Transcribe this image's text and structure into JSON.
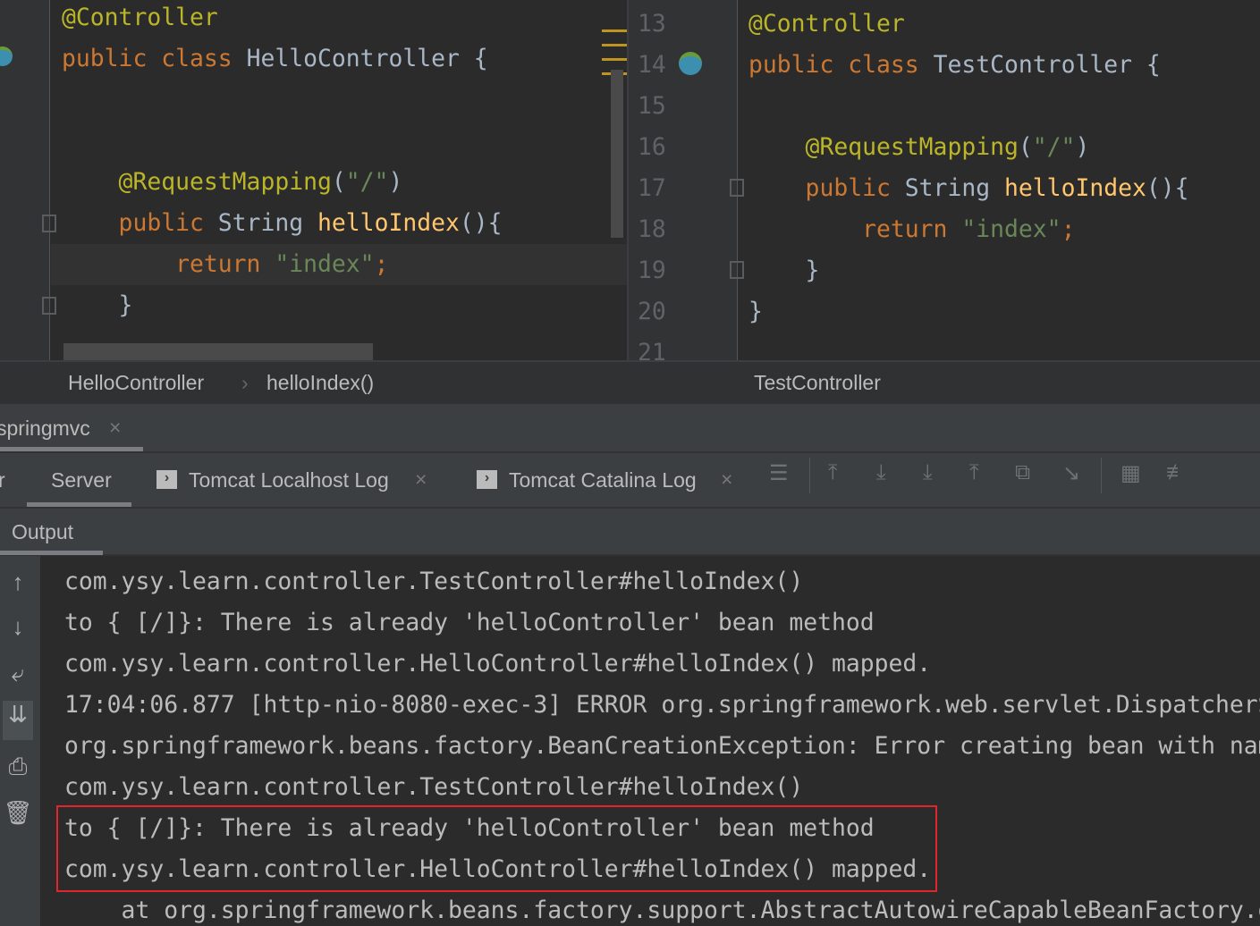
{
  "left_editor": {
    "lines": [
      [
        {
          "t": "@Controller",
          "c": "an"
        }
      ],
      [
        {
          "t": "public ",
          "c": "kw"
        },
        {
          "t": "class ",
          "c": "kw"
        },
        {
          "t": "HelloController {",
          "c": "tx"
        }
      ],
      [],
      [],
      [
        {
          "t": "    @RequestMapping",
          "c": "an"
        },
        {
          "t": "(",
          "c": "tx"
        },
        {
          "t": "\"/\"",
          "c": "st"
        },
        {
          "t": ")",
          "c": "tx"
        }
      ],
      [
        {
          "t": "    public ",
          "c": "kw"
        },
        {
          "t": "String ",
          "c": "tx"
        },
        {
          "t": "helloIndex",
          "c": "fn"
        },
        {
          "t": "(){",
          "c": "tx"
        }
      ],
      [
        {
          "t": "        return ",
          "c": "kw"
        },
        {
          "t": "\"index\"",
          "c": "st"
        },
        {
          "t": ";",
          "c": "kw"
        }
      ],
      [
        {
          "t": "    }",
          "c": "tx"
        }
      ]
    ]
  },
  "right_editor": {
    "line_numbers": [
      "13",
      "14",
      "15",
      "16",
      "17",
      "18",
      "19",
      "20",
      "21"
    ],
    "lines": [
      [
        {
          "t": "@Controller",
          "c": "an"
        }
      ],
      [
        {
          "t": "public ",
          "c": "kw"
        },
        {
          "t": "class ",
          "c": "kw"
        },
        {
          "t": "TestController {",
          "c": "tx"
        }
      ],
      [],
      [
        {
          "t": "    @RequestMapping",
          "c": "an"
        },
        {
          "t": "(",
          "c": "tx"
        },
        {
          "t": "\"/\"",
          "c": "st"
        },
        {
          "t": ")",
          "c": "tx"
        }
      ],
      [
        {
          "t": "    public ",
          "c": "kw"
        },
        {
          "t": "String ",
          "c": "tx"
        },
        {
          "t": "helloIndex",
          "c": "fn"
        },
        {
          "t": "(){",
          "c": "tx"
        }
      ],
      [
        {
          "t": "        return ",
          "c": "kw"
        },
        {
          "t": "\"index\"",
          "c": "st"
        },
        {
          "t": ";",
          "c": "kw"
        }
      ],
      [
        {
          "t": "    }",
          "c": "tx"
        }
      ],
      [
        {
          "t": "}",
          "c": "tx"
        }
      ]
    ]
  },
  "breadcrumb": {
    "left": [
      "HelloController",
      "helloIndex()"
    ],
    "separator": "›",
    "right": "TestController"
  },
  "run_tab": {
    "label": "springmvc",
    "close": "×"
  },
  "server_tabs": {
    "partial": "r",
    "server": "Server",
    "localhost_log": "Tomcat Localhost Log",
    "catalina_log": "Tomcat Catalina Log",
    "close": "×"
  },
  "output_tab": "Output",
  "console_lines": [
    "com.ysy.learn.controller.TestController#helloIndex()",
    "to { [/]}: There is already 'helloController' bean method",
    "com.ysy.learn.controller.HelloController#helloIndex() mapped.",
    "17:04:06.877 [http-nio-8080-exec-3] ERROR org.springframework.web.servlet.DispatcherServlet",
    "org.springframework.beans.factory.BeanCreationException: Error creating bean with name",
    "com.ysy.learn.controller.TestController#helloIndex()",
    "to { [/]}: There is already 'helloController' bean method",
    "com.ysy.learn.controller.HelloController#helloIndex() mapped.",
    "    at org.springframework.beans.factory.support.AbstractAutowireCapableBeanFactory.doCreateBean"
  ],
  "colors": {
    "highlight_box": "#e0262b",
    "keyword": "#cc7832",
    "annotation": "#bbb529",
    "string": "#6a8759",
    "method": "#ffc66d"
  }
}
